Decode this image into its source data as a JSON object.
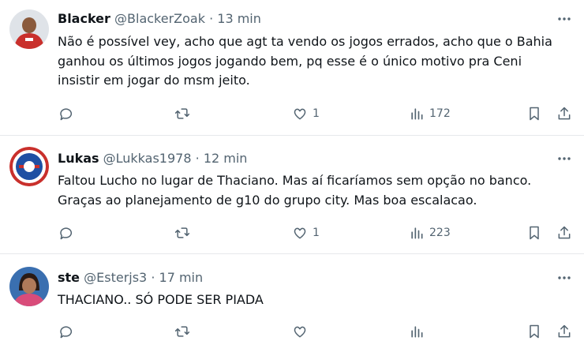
{
  "tweets": [
    {
      "name": "Blacker",
      "handle": "@BlackerZoak",
      "dot": "·",
      "time": "13 min",
      "lines": [
        "Não é possível vey, acho que agt ta vendo os jogos errados, acho que o Bahia",
        "ganhou os últimos jogos jogando bem, pq esse é o único motivo pra Ceni",
        "insistir em jogar do msm jeito."
      ],
      "likes": "1",
      "views": "172",
      "avatar_color": "#c9302c"
    },
    {
      "name": "Lukas",
      "handle": "@Lukkas1978",
      "dot": "·",
      "time": "12 min",
      "lines": [
        "Faltou Lucho no lugar de Thaciano. Mas aí ficaríamos sem opção no banco.",
        "Graças ao planejamento de g10 do grupo city. Mas boa escalacao."
      ],
      "likes": "1",
      "views": "223",
      "avatar_color": "#1f4fa3"
    },
    {
      "name": "ste",
      "handle": "@Esterjs3",
      "dot": "·",
      "time": "17 min",
      "lines": [
        "THACIANO.. SÓ PODE SER PIADA"
      ],
      "likes": "",
      "views": "",
      "avatar_color": "#d94c7a"
    }
  ],
  "icons": {
    "more": "more-icon",
    "reply": "reply-icon",
    "retweet": "retweet-icon",
    "like": "heart-icon",
    "views": "views-icon",
    "bookmark": "bookmark-icon",
    "share": "share-icon"
  },
  "colors": {
    "text": "#0f1419",
    "secondary": "#536471",
    "divider": "#e6e9ec"
  }
}
